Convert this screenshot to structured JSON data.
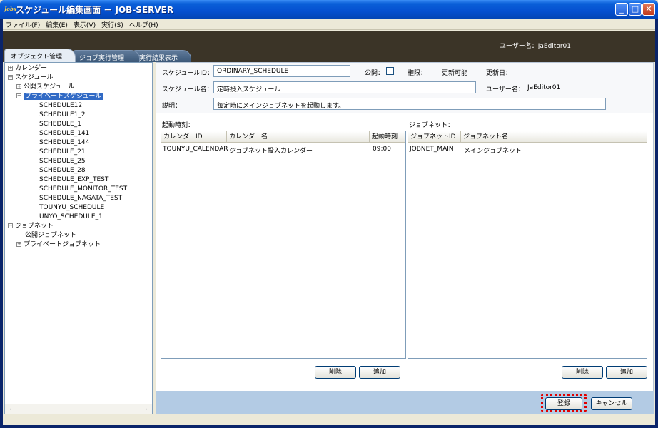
{
  "window": {
    "title": "スケジュール編集画面 － JOB-SERVER",
    "app_icon": "Jobs"
  },
  "menu": [
    "ファイル(F)",
    "編集(E)",
    "表示(V)",
    "実行(S)",
    "ヘルプ(H)"
  ],
  "header": {
    "user_label": "ユーザー名：JaEditor01"
  },
  "tabs": [
    "オブジェクト管理",
    "ジョブ実行管理",
    "実行結果表示"
  ],
  "tree": [
    {
      "label": "カレンダー",
      "exp": "+",
      "level": 0
    },
    {
      "label": "スケジュール",
      "exp": "-",
      "level": 0
    },
    {
      "label": "公開スケジュール",
      "exp": "+",
      "level": 1
    },
    {
      "label": "プライベートスケジュール",
      "exp": "-",
      "level": 1,
      "selected": true
    },
    {
      "label": "SCHEDULE12",
      "level": 3
    },
    {
      "label": "SCHEDULE1_2",
      "level": 3
    },
    {
      "label": "SCHEDULE_1",
      "level": 3
    },
    {
      "label": "SCHEDULE_141",
      "level": 3
    },
    {
      "label": "SCHEDULE_144",
      "level": 3
    },
    {
      "label": "SCHEDULE_21",
      "level": 3
    },
    {
      "label": "SCHEDULE_25",
      "level": 3
    },
    {
      "label": "SCHEDULE_28",
      "level": 3
    },
    {
      "label": "SCHEDULE_EXP_TEST",
      "level": 3
    },
    {
      "label": "SCHEDULE_MONITOR_TEST",
      "level": 3
    },
    {
      "label": "SCHEDULE_NAGATA_TEST",
      "level": 3
    },
    {
      "label": "TOUNYU_SCHEDULE",
      "level": 3
    },
    {
      "label": "UNYO_SCHEDULE_1",
      "level": 3
    },
    {
      "label": "ジョブネット",
      "exp": "-",
      "level": 0
    },
    {
      "label": "公開ジョブネット",
      "level": 2
    },
    {
      "label": "プライベートジョブネット",
      "exp": "+",
      "level": 1
    }
  ],
  "form": {
    "schedule_id_label": "スケジュールID：",
    "schedule_id_value": "ORDINARY_SCHEDULE",
    "public_label": "公開：",
    "public_checked": false,
    "permission_label": "権限：",
    "permission_value": "更新可能",
    "updated_label": "更新日：",
    "schedule_name_label": "スケジュール名：",
    "schedule_name_value": "定時投入スケジュール",
    "username_label": "ユーザー名：",
    "username_value": "JaEditor01",
    "description_label": "説明：",
    "description_value": "毎定時にメインジョブネットを起動します。"
  },
  "start_times": {
    "section_label": "起動時刻：",
    "columns": [
      "カレンダーID",
      "カレンダー名",
      "起動時刻"
    ],
    "rows": [
      [
        "TOUNYU_CALENDAR",
        "ジョブネット投入カレンダー",
        "09:00"
      ]
    ],
    "delete_label": "削除",
    "add_label": "追加"
  },
  "jobnets": {
    "section_label": "ジョブネット：",
    "columns": [
      "ジョブネットID",
      "ジョブネット名"
    ],
    "rows": [
      [
        "JOBNET_MAIN",
        "メインジョブネット"
      ]
    ],
    "delete_label": "削除",
    "add_label": "追加"
  },
  "footer": {
    "register_label": "登録",
    "cancel_label": "キャンセル"
  },
  "colors": {
    "titlebar": "#0550d0",
    "header": "#3b3427",
    "selection": "#316ac5",
    "bottombar": "#b3cbe4",
    "highlight": "#e00000"
  }
}
